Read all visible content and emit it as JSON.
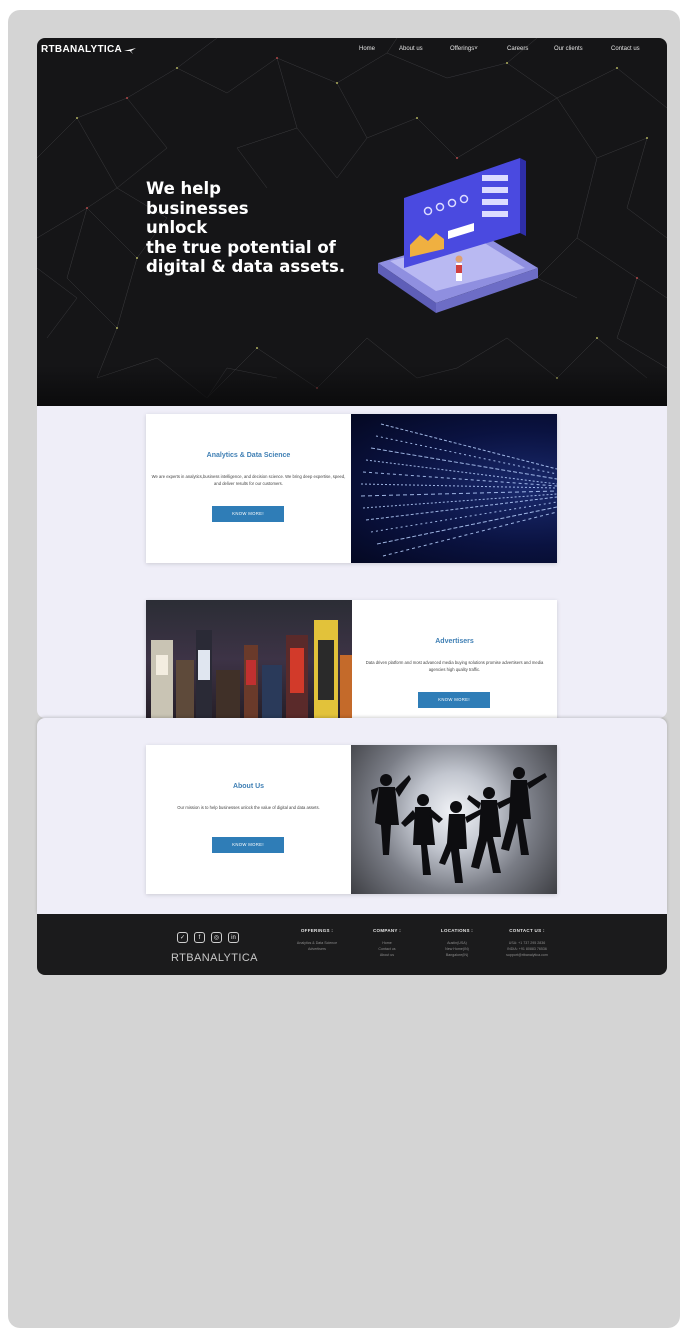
{
  "brand": {
    "name": "RTBANALYTICA"
  },
  "nav": {
    "home": "Home",
    "about": "About us",
    "offerings": "Offerings",
    "careers": "Careers",
    "clients": "Our clients",
    "contact": "Contact us"
  },
  "hero": {
    "line1": "We help",
    "line2": "businesses",
    "line3": "unlock",
    "line4": "the true potential of",
    "line5": "digital & data assets."
  },
  "sections": {
    "analytics": {
      "title": "Analytics & Data Science",
      "desc": "We are experts in analytics,business intelligence, and decision science. We bring deep expertise, speed, and deliver results for our customers.",
      "button": "KNOW MORE!"
    },
    "advertisers": {
      "title": "Advertisers",
      "desc": "Data driven platform and most advanced media buying solutions promise advertisers and media agencies high quality traffic.",
      "button": "KNOW MORE!"
    },
    "about": {
      "title": "About Us",
      "desc": "Our mission is to help businesses unlock the value of digital and data assets.",
      "button": "KNOW MORE!"
    }
  },
  "footer": {
    "logo": "RTBANALYTICA",
    "social_icons": [
      "twitter-icon",
      "facebook-icon",
      "instagram-icon",
      "linkedin-icon"
    ],
    "offerings": {
      "heading": "OFFERINGS :",
      "items": [
        "Analytics & Data Science",
        "Advertisers"
      ]
    },
    "company": {
      "heading": "COMPANY :",
      "items": [
        "Home",
        "Contact us",
        "About us"
      ]
    },
    "locations": {
      "heading": "LOCATIONS :",
      "items": [
        "Austin(USA)",
        "New Home(IN)",
        "Bangalore(IN)"
      ]
    },
    "contact": {
      "heading": "CONTACT US :",
      "items": [
        "USA: +1 737 295 2836",
        "INDIA: +91 80883 76536",
        "support@rtbanalytica.com"
      ]
    }
  },
  "colors": {
    "accent": "#2f7db7",
    "title_blue": "#3f7fb4",
    "panel_bg": "#efeef8",
    "hero_bg": "#151517",
    "footer_bg": "#1b1b1c"
  }
}
